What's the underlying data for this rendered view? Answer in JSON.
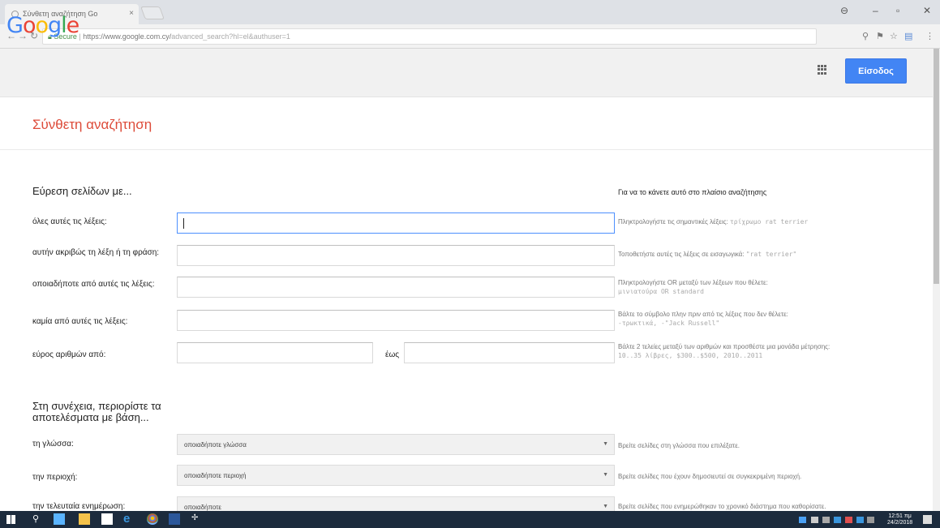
{
  "browser": {
    "tab_title": "Σύνθετη αναζήτηση Go",
    "tab_close": "×",
    "url_secure": "Secure",
    "url_main": "https://www.google.com.cy/",
    "url_rest": "advanced_search?hl=el&authuser=1"
  },
  "header": {
    "logo_letters": [
      {
        "ch": "G",
        "color": "#4285f4"
      },
      {
        "ch": "o",
        "color": "#ea4335"
      },
      {
        "ch": "o",
        "color": "#fbbc05"
      },
      {
        "ch": "g",
        "color": "#4285f4"
      },
      {
        "ch": "l",
        "color": "#34a853"
      },
      {
        "ch": "e",
        "color": "#ea4335"
      }
    ],
    "signin_label": "Είσοδος"
  },
  "page": {
    "title": "Σύνθετη αναζήτηση",
    "find_pages_heading": "Εύρεση σελίδων με...",
    "hint_heading": "Για να το κάνετε αυτό στο πλαίσιο αναζήτησης",
    "rows": [
      {
        "label": "όλες αυτές τις λέξεις:",
        "hint": "Πληκτρολογήστε τις σημαντικές λέξεις:",
        "hint_code": "τρίχρωμο rat terrier"
      },
      {
        "label": "αυτήν ακριβώς τη λέξη ή τη φράση:",
        "hint": "Τοποθετήστε αυτές τις λέξεις σε εισαγωγικά:",
        "hint_code": "\"rat terrier\""
      },
      {
        "label": "οποιαδήποτε από αυτές τις λέξεις:",
        "hint": "Πληκτρολογήστε OR μεταξύ των λέξεων που θέλετε:",
        "hint_code": "μινιατούρα OR standard"
      },
      {
        "label": "καμία από αυτές τις λέξεις:",
        "hint": "Βάλτε το σύμβολο πλην πριν από τις λέξεις που δεν θέλετε:",
        "hint_code": "-τρωκτικά, -\"Jack Russell\""
      },
      {
        "label": "εύρος αριθμών από:",
        "to_label": "έως",
        "hint": "Βάλτε 2 τελείες μεταξύ των αριθμών και προσθέστε μια μονάδα μέτρησης:",
        "hint_code": "10..35 λίβρες, $300..$500, 2010..2011"
      }
    ],
    "narrow_heading": "Στη συνέχεια, περιορίστε τα αποτελέσματα με βάση...",
    "narrow_rows": [
      {
        "label": "τη γλώσσα:",
        "value": "οποιαδήποτε γλώσσα",
        "hint": "Βρείτε σελίδες στη γλώσσα που επιλέξατε."
      },
      {
        "label": "την περιοχή:",
        "value": "οποιαδήποτε περιοχή",
        "hint": "Βρείτε σελίδες που έχουν δημοσιευτεί σε συγκεκριμένη περιοχή."
      },
      {
        "label": "την τελευταία ενημέρωση:",
        "value": "οποιαδήποτε",
        "hint": "Βρείτε σελίδες που ενημερώθηκαν το χρονικό διάστημα που καθορίσατε."
      }
    ]
  },
  "taskbar": {
    "clock_time": "12:51 πμ",
    "clock_date": "24/2/2018"
  }
}
